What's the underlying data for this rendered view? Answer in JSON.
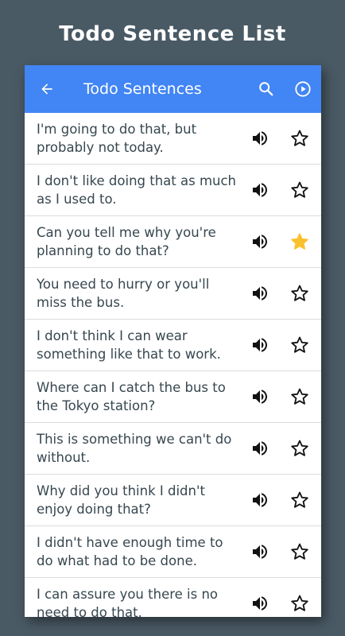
{
  "promo_title": "Todo Sentence List",
  "appbar": {
    "title": "Todo Sentences",
    "back_icon": "arrow-back-icon",
    "search_icon": "search-icon",
    "play_icon": "play-circle-icon",
    "color": "#4285f4"
  },
  "sentences": [
    {
      "text": "I'm going to do that, but probably not today.",
      "starred": false
    },
    {
      "text": "I don't like doing that as much as I used to.",
      "starred": false
    },
    {
      "text": "Can you tell me why you're planning to do that?",
      "starred": true
    },
    {
      "text": "You need to hurry or you'll miss the bus.",
      "starred": false
    },
    {
      "text": "I don't think I can wear something like that to work.",
      "starred": false
    },
    {
      "text": "Where can I catch the bus to the Tokyo station?",
      "starred": false
    },
    {
      "text": "This is something we can't do without.",
      "starred": false
    },
    {
      "text": "Why did you think I didn't enjoy doing that?",
      "starred": false
    },
    {
      "text": "I didn't have enough time to do what had to be done.",
      "starred": false
    },
    {
      "text": "I can assure you there is no need to do that.",
      "starred": false
    }
  ],
  "colors": {
    "background": "#4a5a65",
    "star_filled": "#fbc02d",
    "text": "#37474f"
  }
}
